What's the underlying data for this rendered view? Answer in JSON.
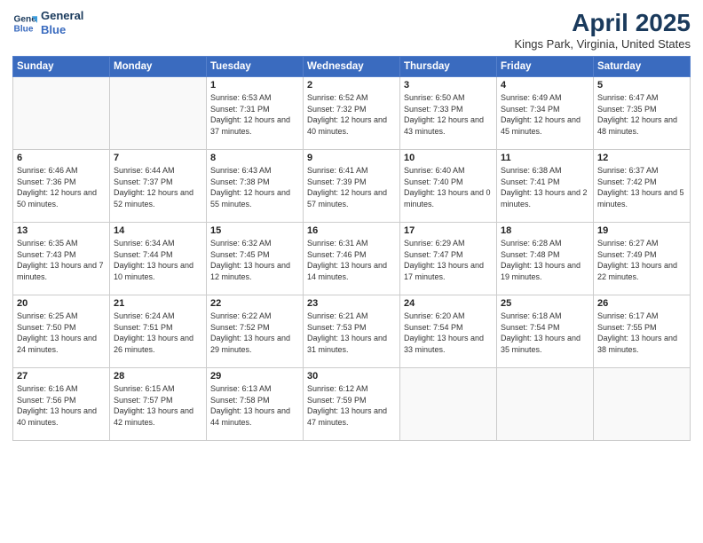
{
  "logo": {
    "line1": "General",
    "line2": "Blue"
  },
  "title": "April 2025",
  "subtitle": "Kings Park, Virginia, United States",
  "days_of_week": [
    "Sunday",
    "Monday",
    "Tuesday",
    "Wednesday",
    "Thursday",
    "Friday",
    "Saturday"
  ],
  "weeks": [
    [
      {
        "day": "",
        "info": ""
      },
      {
        "day": "",
        "info": ""
      },
      {
        "day": "1",
        "info": "Sunrise: 6:53 AM\nSunset: 7:31 PM\nDaylight: 12 hours and 37 minutes."
      },
      {
        "day": "2",
        "info": "Sunrise: 6:52 AM\nSunset: 7:32 PM\nDaylight: 12 hours and 40 minutes."
      },
      {
        "day": "3",
        "info": "Sunrise: 6:50 AM\nSunset: 7:33 PM\nDaylight: 12 hours and 43 minutes."
      },
      {
        "day": "4",
        "info": "Sunrise: 6:49 AM\nSunset: 7:34 PM\nDaylight: 12 hours and 45 minutes."
      },
      {
        "day": "5",
        "info": "Sunrise: 6:47 AM\nSunset: 7:35 PM\nDaylight: 12 hours and 48 minutes."
      }
    ],
    [
      {
        "day": "6",
        "info": "Sunrise: 6:46 AM\nSunset: 7:36 PM\nDaylight: 12 hours and 50 minutes."
      },
      {
        "day": "7",
        "info": "Sunrise: 6:44 AM\nSunset: 7:37 PM\nDaylight: 12 hours and 52 minutes."
      },
      {
        "day": "8",
        "info": "Sunrise: 6:43 AM\nSunset: 7:38 PM\nDaylight: 12 hours and 55 minutes."
      },
      {
        "day": "9",
        "info": "Sunrise: 6:41 AM\nSunset: 7:39 PM\nDaylight: 12 hours and 57 minutes."
      },
      {
        "day": "10",
        "info": "Sunrise: 6:40 AM\nSunset: 7:40 PM\nDaylight: 13 hours and 0 minutes."
      },
      {
        "day": "11",
        "info": "Sunrise: 6:38 AM\nSunset: 7:41 PM\nDaylight: 13 hours and 2 minutes."
      },
      {
        "day": "12",
        "info": "Sunrise: 6:37 AM\nSunset: 7:42 PM\nDaylight: 13 hours and 5 minutes."
      }
    ],
    [
      {
        "day": "13",
        "info": "Sunrise: 6:35 AM\nSunset: 7:43 PM\nDaylight: 13 hours and 7 minutes."
      },
      {
        "day": "14",
        "info": "Sunrise: 6:34 AM\nSunset: 7:44 PM\nDaylight: 13 hours and 10 minutes."
      },
      {
        "day": "15",
        "info": "Sunrise: 6:32 AM\nSunset: 7:45 PM\nDaylight: 13 hours and 12 minutes."
      },
      {
        "day": "16",
        "info": "Sunrise: 6:31 AM\nSunset: 7:46 PM\nDaylight: 13 hours and 14 minutes."
      },
      {
        "day": "17",
        "info": "Sunrise: 6:29 AM\nSunset: 7:47 PM\nDaylight: 13 hours and 17 minutes."
      },
      {
        "day": "18",
        "info": "Sunrise: 6:28 AM\nSunset: 7:48 PM\nDaylight: 13 hours and 19 minutes."
      },
      {
        "day": "19",
        "info": "Sunrise: 6:27 AM\nSunset: 7:49 PM\nDaylight: 13 hours and 22 minutes."
      }
    ],
    [
      {
        "day": "20",
        "info": "Sunrise: 6:25 AM\nSunset: 7:50 PM\nDaylight: 13 hours and 24 minutes."
      },
      {
        "day": "21",
        "info": "Sunrise: 6:24 AM\nSunset: 7:51 PM\nDaylight: 13 hours and 26 minutes."
      },
      {
        "day": "22",
        "info": "Sunrise: 6:22 AM\nSunset: 7:52 PM\nDaylight: 13 hours and 29 minutes."
      },
      {
        "day": "23",
        "info": "Sunrise: 6:21 AM\nSunset: 7:53 PM\nDaylight: 13 hours and 31 minutes."
      },
      {
        "day": "24",
        "info": "Sunrise: 6:20 AM\nSunset: 7:54 PM\nDaylight: 13 hours and 33 minutes."
      },
      {
        "day": "25",
        "info": "Sunrise: 6:18 AM\nSunset: 7:54 PM\nDaylight: 13 hours and 35 minutes."
      },
      {
        "day": "26",
        "info": "Sunrise: 6:17 AM\nSunset: 7:55 PM\nDaylight: 13 hours and 38 minutes."
      }
    ],
    [
      {
        "day": "27",
        "info": "Sunrise: 6:16 AM\nSunset: 7:56 PM\nDaylight: 13 hours and 40 minutes."
      },
      {
        "day": "28",
        "info": "Sunrise: 6:15 AM\nSunset: 7:57 PM\nDaylight: 13 hours and 42 minutes."
      },
      {
        "day": "29",
        "info": "Sunrise: 6:13 AM\nSunset: 7:58 PM\nDaylight: 13 hours and 44 minutes."
      },
      {
        "day": "30",
        "info": "Sunrise: 6:12 AM\nSunset: 7:59 PM\nDaylight: 13 hours and 47 minutes."
      },
      {
        "day": "",
        "info": ""
      },
      {
        "day": "",
        "info": ""
      },
      {
        "day": "",
        "info": ""
      }
    ]
  ]
}
